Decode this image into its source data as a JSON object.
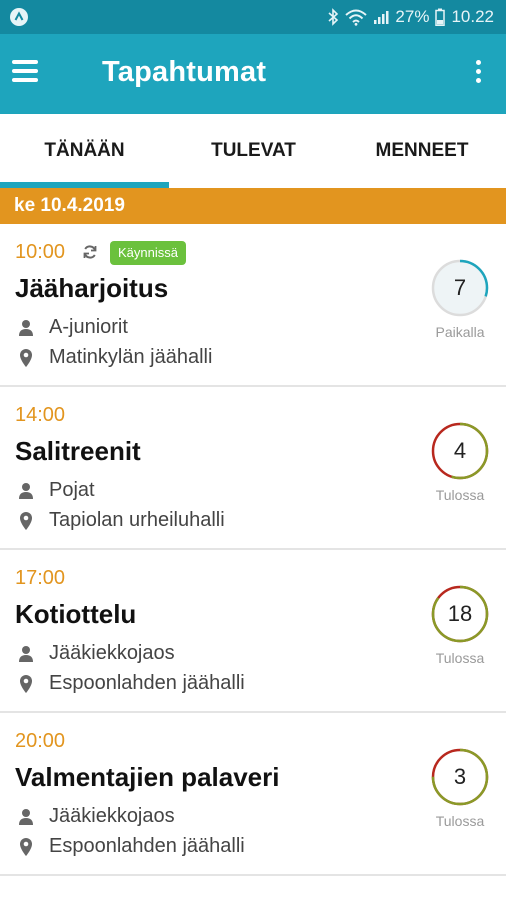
{
  "status_bar": {
    "battery_percent": "27%",
    "time": "10.22"
  },
  "app_bar": {
    "title": "Tapahtumat",
    "menu_icon": "hamburger-menu-icon",
    "overflow_icon": "more-vert-icon"
  },
  "tabs": [
    {
      "label": "TÄNÄÄN",
      "active": true
    },
    {
      "label": "TULEVAT",
      "active": false
    },
    {
      "label": "MENNEET",
      "active": false
    }
  ],
  "date_header": "ke 10.4.2019",
  "colors": {
    "primary": "#1ea5bd",
    "primary_dark": "#1489a0",
    "accent_orange": "#e2951f",
    "badge_green": "#6bc13d",
    "ring_olive": "#8a9a28",
    "ring_red": "#b8281e",
    "ring_teal": "#1ea5bd"
  },
  "events": [
    {
      "time": "10:00",
      "badge": "Käynnissä",
      "title": "Jääharjoitus",
      "group": "A-juniorit",
      "location": "Matinkylän jäähalli",
      "count": "7",
      "status": "Paikalla",
      "ring_fraction": 0.3
    },
    {
      "time": "14:00",
      "badge": "",
      "title": "Salitreenit",
      "group": "Pojat",
      "location": "Tapiolan urheiluhalli",
      "count": "4",
      "status": "Tulossa",
      "ring_fraction": 0.55
    },
    {
      "time": "17:00",
      "badge": "",
      "title": "Kotiottelu",
      "group": "Jääkiekkojaos",
      "location": "Espoonlahden jäähalli",
      "count": "18",
      "status": "Tulossa",
      "ring_fraction": 0.85
    },
    {
      "time": "20:00",
      "badge": "",
      "title": "Valmentajien palaveri",
      "group": "Jääkiekkojaos",
      "location": "Espoonlahden jäähalli",
      "count": "3",
      "status": "Tulossa",
      "ring_fraction": 0.75
    }
  ]
}
